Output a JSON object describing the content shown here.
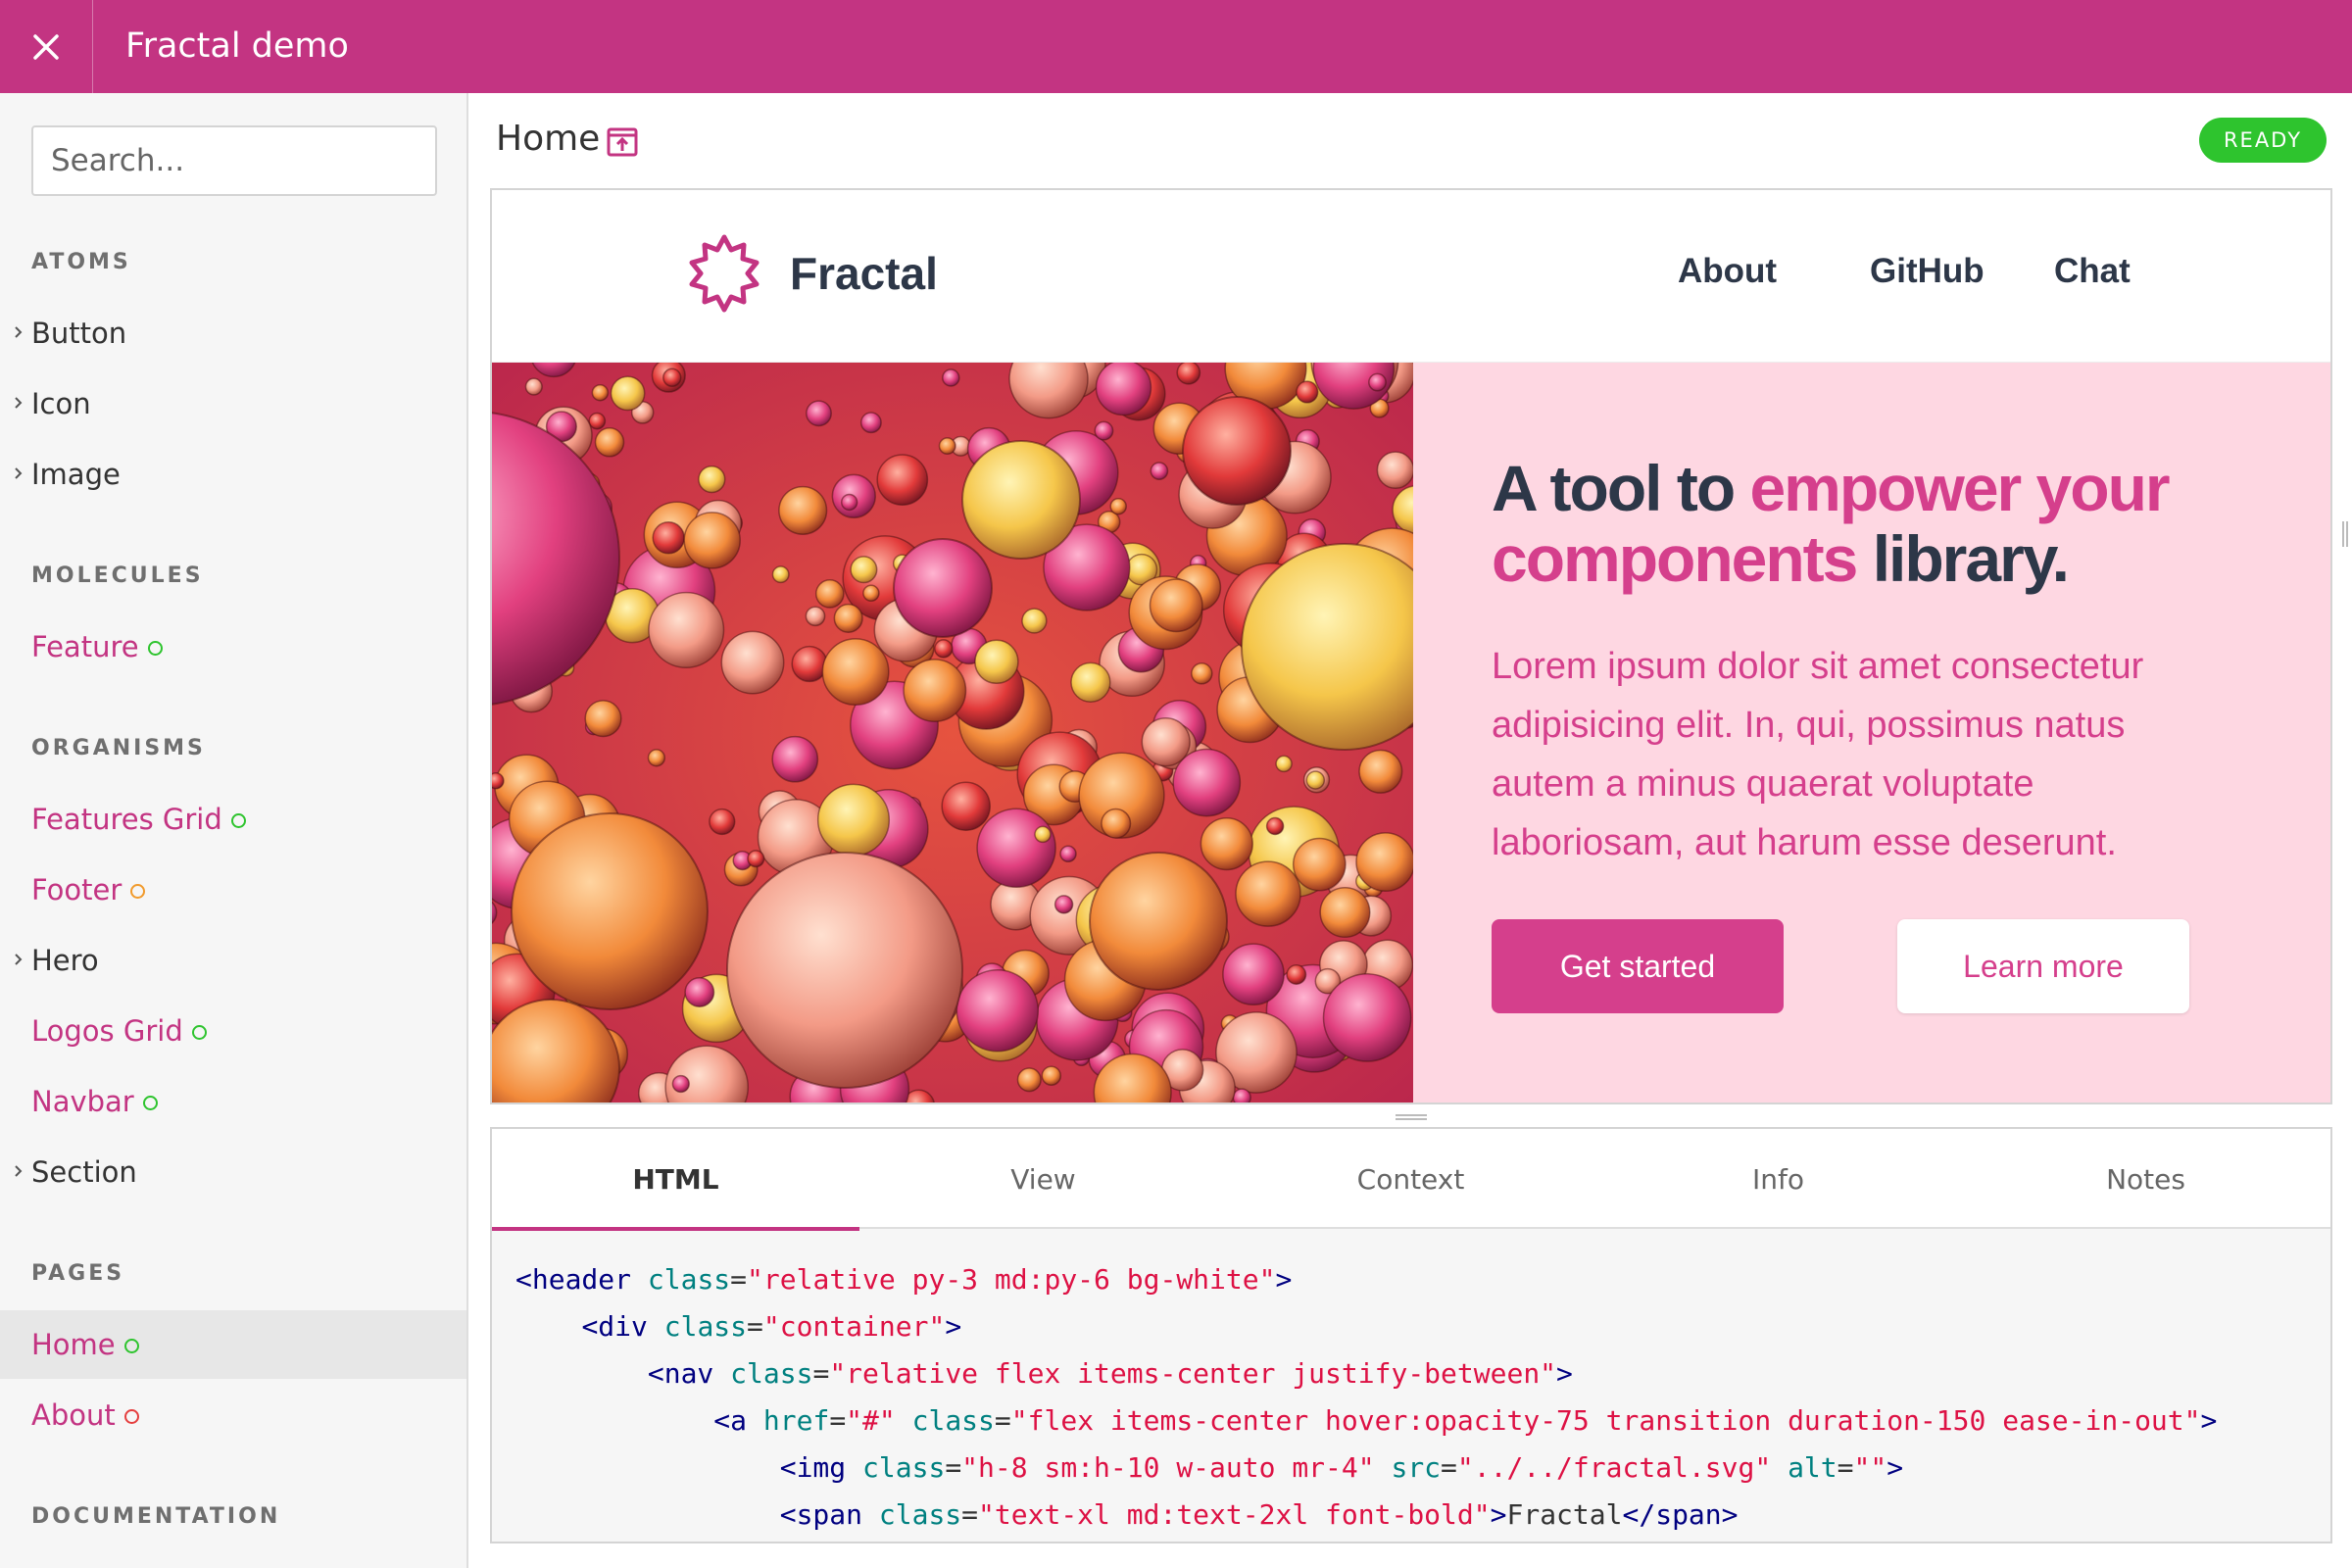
{
  "app": {
    "title": "Fractal demo"
  },
  "sidebar": {
    "search_placeholder": "Search...",
    "sections": {
      "atoms": {
        "heading": "ATOMS",
        "items": [
          "Button",
          "Icon",
          "Image"
        ]
      },
      "molecules": {
        "heading": "MOLECULES",
        "items": [
          "Feature"
        ]
      },
      "organisms": {
        "heading": "ORGANISMS",
        "items": [
          "Features Grid",
          "Footer",
          "Hero",
          "Logos Grid",
          "Navbar",
          "Section"
        ]
      },
      "pages": {
        "heading": "PAGES",
        "items": [
          "Home",
          "About"
        ]
      },
      "documentation": {
        "heading": "DOCUMENTATION"
      }
    }
  },
  "main": {
    "title": "Home",
    "status": "READY"
  },
  "preview": {
    "brand": "Fractal",
    "nav": [
      "About",
      "GitHub",
      "Chat"
    ],
    "headline_dark_1": "A tool to ",
    "headline_accent": "empower your components",
    "headline_dark_2": " library.",
    "lead": "Lorem ipsum dolor sit amet consectetur adipisicing elit. In, qui, possimus natus autem a minus quaerat voluptate laboriosam, aut harum esse deserunt.",
    "primary_button": "Get started",
    "secondary_button": "Learn more"
  },
  "tabs": [
    "HTML",
    "View",
    "Context",
    "Info",
    "Notes"
  ],
  "code_lines": [
    {
      "indent": "",
      "tag": "<header",
      "parts": [
        [
          "class",
          "\"relative py-3 md:py-6 bg-white\""
        ]
      ],
      "close": ">"
    },
    {
      "indent": "    ",
      "tag": "<div",
      "parts": [
        [
          "class",
          "\"container\""
        ]
      ],
      "close": ">"
    },
    {
      "indent": "        ",
      "tag": "<nav",
      "parts": [
        [
          "class",
          "\"relative flex items-center justify-between\""
        ]
      ],
      "close": ">"
    },
    {
      "indent": "            ",
      "tag": "<a",
      "parts": [
        [
          "href",
          "\"#\""
        ],
        [
          "class",
          "\"flex items-center hover:opacity-75 transition duration-150 ease-in-out\""
        ]
      ],
      "close": ">"
    },
    {
      "indent": "                ",
      "tag": "<img",
      "parts": [
        [
          "class",
          "\"h-8 sm:h-10 w-auto mr-4\""
        ],
        [
          "src",
          "\"../../fractal.svg\""
        ],
        [
          "alt",
          "\"\""
        ]
      ],
      "close": ">"
    },
    {
      "indent": "                ",
      "tag": "<span",
      "parts": [
        [
          "class",
          "\"text-xl md:text-2xl font-bold\""
        ]
      ],
      "close": ">",
      "text": "Fractal",
      "end": "</span>"
    }
  ],
  "colors": {
    "brand": "#c33482",
    "accent": "#d53f8c",
    "ready": "#2ec42e",
    "hero_bg": "#fed7e2"
  }
}
